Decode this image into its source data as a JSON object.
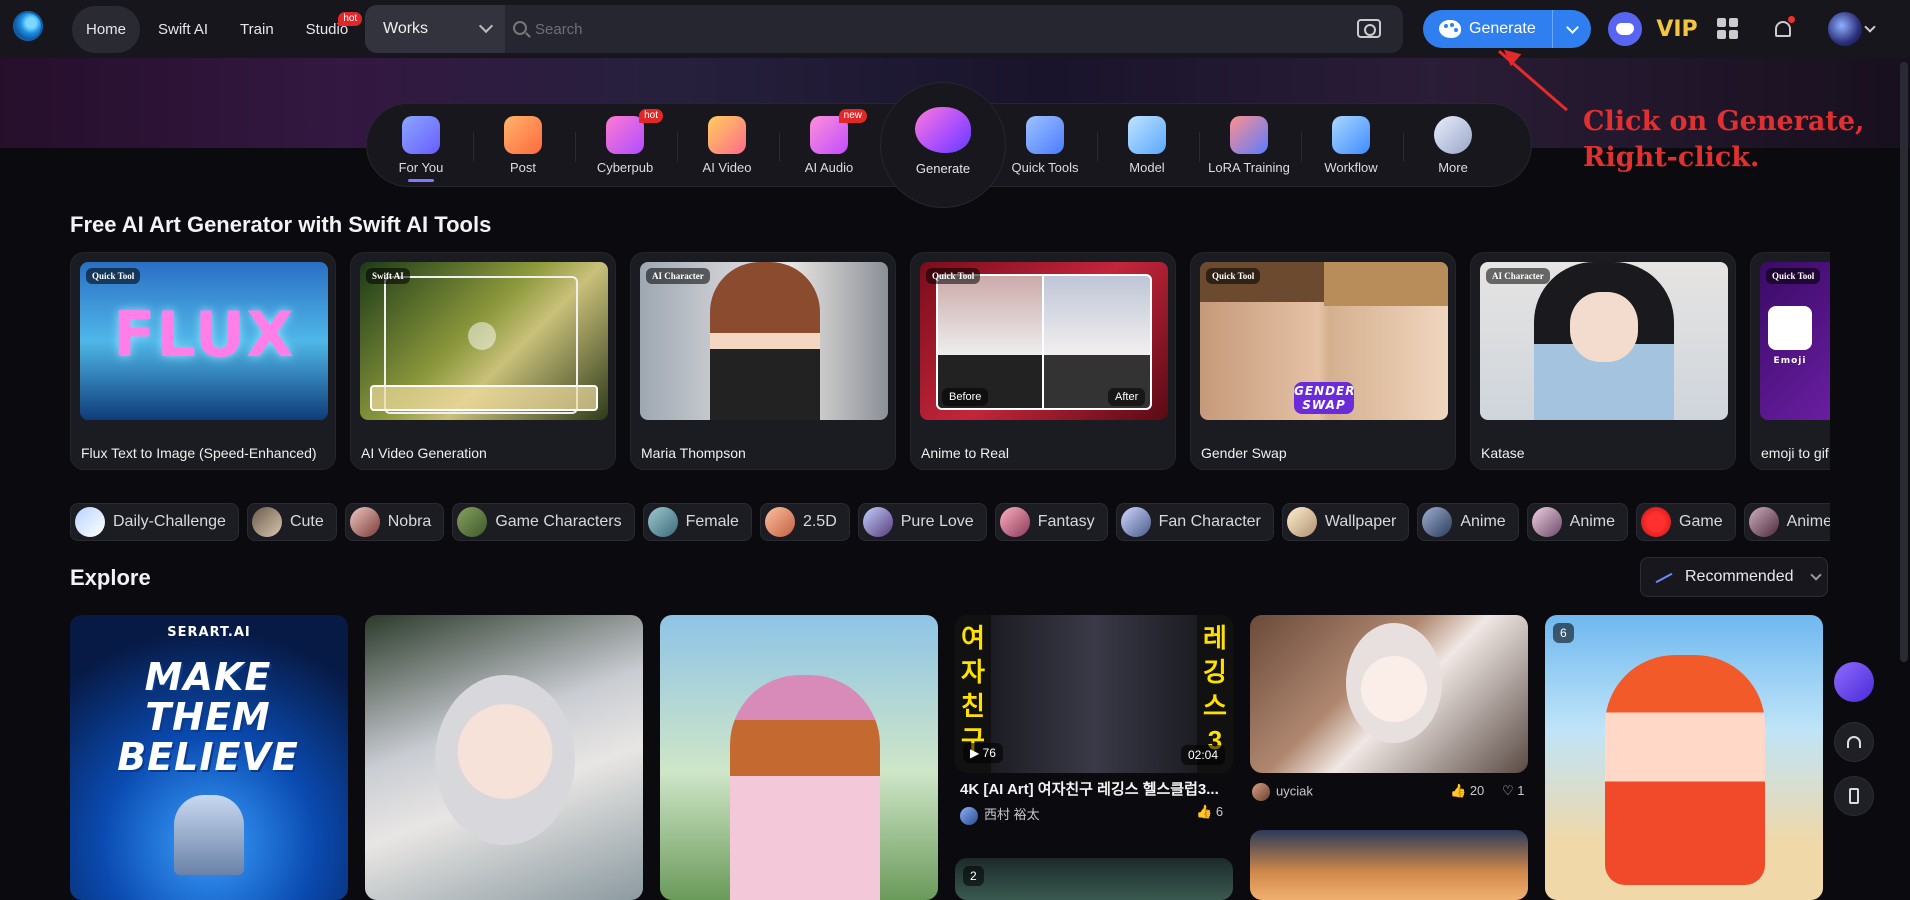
{
  "nav": {
    "items": [
      {
        "label": "Home"
      },
      {
        "label": "Swift AI"
      },
      {
        "label": "Train"
      },
      {
        "label": "Studio",
        "badge": "hot"
      }
    ]
  },
  "search": {
    "scope": "Works",
    "placeholder": "Search"
  },
  "generate": {
    "label": "Generate"
  },
  "vip": {
    "label": "VIP"
  },
  "categories": [
    {
      "label": "For You",
      "active": true
    },
    {
      "label": "Post"
    },
    {
      "label": "Cyberpub",
      "badge": "hot"
    },
    {
      "label": "AI Video"
    },
    {
      "label": "AI Audio",
      "badge": "new"
    },
    {
      "label": "Generate"
    },
    {
      "label": "Quick Tools"
    },
    {
      "label": "Model"
    },
    {
      "label": "LoRA Training"
    },
    {
      "label": "Workflow"
    },
    {
      "label": "More"
    }
  ],
  "annotation": {
    "line1": "Click on Generate,",
    "line2": "Right-click."
  },
  "tools_section": {
    "title": "Free AI Art Generator with Swift AI Tools",
    "items": [
      {
        "tag": "Quick Tool",
        "name": "Flux Text to Image (Speed-Enhanced)",
        "thumb_text": "FLUX"
      },
      {
        "tag": "Swift AI",
        "name": "AI Video Generation"
      },
      {
        "tag": "AI Character",
        "name": "Maria Thompson"
      },
      {
        "tag": "Quick Tool",
        "name": "Anime to Real",
        "before": "Before",
        "after": "After"
      },
      {
        "tag": "Quick Tool",
        "name": "Gender Swap",
        "thumb_text": "GENDER SWAP"
      },
      {
        "tag": "AI Character",
        "name": "Katase"
      },
      {
        "tag": "Quick Tool",
        "name": "emoji to gif",
        "thumb_text": "Emoji"
      }
    ]
  },
  "tags": [
    "Daily-Challenge",
    "Cute",
    "Nobra",
    "Game Characters",
    "Female",
    "2.5D",
    "Pure Love",
    "Fantasy",
    "Fan Character",
    "Wallpaper",
    "Anime",
    "Anime",
    "Game",
    "Anime Bishojo"
  ],
  "explore": {
    "title": "Explore",
    "sort_label": "Recommended",
    "cards": [
      {
        "brand": "SERART.AI",
        "headline": "MAKE THEM BELIEVE"
      },
      {},
      {},
      {
        "title": "4K [AI Art] 여자친구 레깅스 헬스클럽3...",
        "author": "西村 裕太",
        "likes": "6",
        "views": "76",
        "duration": "02:04",
        "side_left": "여자친구",
        "side_right": "레깅스3"
      },
      {
        "author": "uyciak",
        "likes": "20",
        "comments": "1"
      },
      {
        "count": "6"
      },
      {
        "count": "2"
      },
      {}
    ]
  },
  "colors": {
    "accent": "#2f7ff0",
    "annotation": "#e03030",
    "badge": "#e02828"
  }
}
